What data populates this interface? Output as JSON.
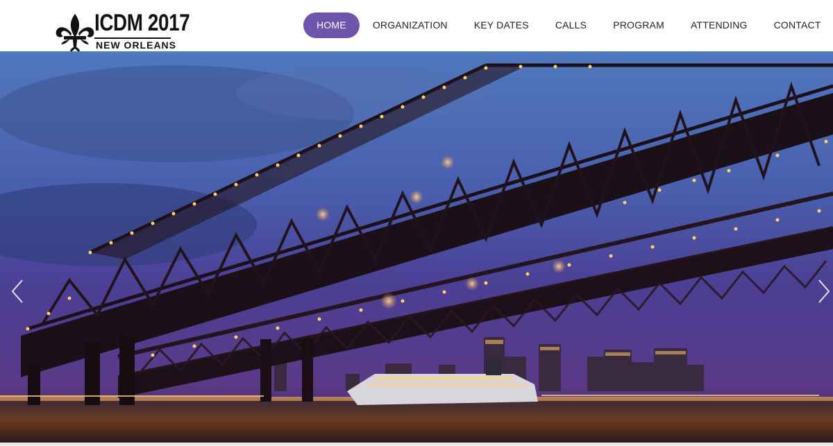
{
  "logo": {
    "title": "ICDM 2017",
    "subtitle": "NEW ORLEANS",
    "icon": "fleur-de-lis-icon"
  },
  "nav": {
    "items": [
      {
        "label": "HOME",
        "active": true
      },
      {
        "label": "ORGANIZATION",
        "active": false
      },
      {
        "label": "KEY DATES",
        "active": false
      },
      {
        "label": "CALLS",
        "active": false
      },
      {
        "label": "PROGRAM",
        "active": false
      },
      {
        "label": "ATTENDING",
        "active": false
      },
      {
        "label": "CONTACT",
        "active": false
      }
    ]
  },
  "hero": {
    "prev_icon": "chevron-left-icon",
    "next_icon": "chevron-right-icon"
  },
  "colors": {
    "accent": "#6f54ad",
    "sky_top": "#4a6fb5",
    "sky_bottom": "#5a3a86",
    "bridge": "#1c1018",
    "light": "#ffb347"
  }
}
